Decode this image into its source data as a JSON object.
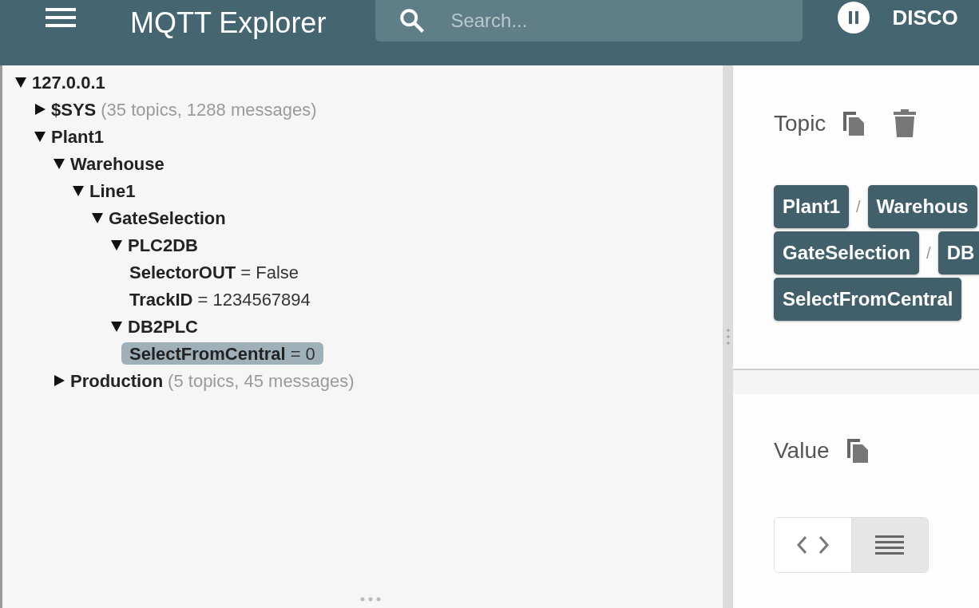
{
  "header": {
    "title": "MQTT Explorer",
    "search": {
      "placeholder": "Search..."
    },
    "connection_button": {
      "label": "DISCO",
      "paused": true
    }
  },
  "tree": [
    {
      "name": "127.0.0.1",
      "expanded": true,
      "selected": false,
      "children": [
        {
          "name": "$SYS",
          "summary": "(35 topics, 1288 messages)",
          "expanded": false,
          "selected": false
        },
        {
          "name": "Plant1",
          "expanded": true,
          "selected": false,
          "children": [
            {
              "name": "Warehouse",
              "expanded": true,
              "selected": false,
              "children": [
                {
                  "name": "Line1",
                  "expanded": true,
                  "selected": false,
                  "children": [
                    {
                      "name": "GateSelection",
                      "expanded": true,
                      "selected": false,
                      "children": [
                        {
                          "name": "PLC2DB",
                          "expanded": true,
                          "selected": false,
                          "children": [
                            {
                              "name": "SelectorOUT",
                              "value": "= False",
                              "selected": false
                            },
                            {
                              "name": "TrackID",
                              "value": "= 1234567894",
                              "selected": false
                            }
                          ]
                        },
                        {
                          "name": "DB2PLC",
                          "expanded": true,
                          "selected": false,
                          "children": [
                            {
                              "name": "SelectFromCentral",
                              "value": "= 0",
                              "selected": true
                            }
                          ]
                        }
                      ]
                    }
                  ]
                }
              ]
            },
            {
              "name": "Production",
              "summary": "(5 topics, 45 messages)",
              "expanded": false,
              "selected": false
            }
          ]
        }
      ]
    }
  ],
  "topic": {
    "label": "Topic",
    "path": [
      {
        "kind": "chip",
        "text": "Plant1"
      },
      {
        "kind": "separator",
        "text": "/"
      },
      {
        "kind": "chip",
        "text": "Warehous"
      },
      {
        "kind": "break"
      },
      {
        "kind": "chip",
        "text": "GateSelection"
      },
      {
        "kind": "separator",
        "text": "/"
      },
      {
        "kind": "chip",
        "text": "DB"
      },
      {
        "kind": "break"
      },
      {
        "kind": "chip",
        "text": "SelectFromCentral"
      }
    ]
  },
  "value": {
    "label": "Value",
    "view_modes": [
      {
        "kind": "code",
        "selected": false
      },
      {
        "kind": "raw",
        "selected": true
      }
    ]
  }
}
